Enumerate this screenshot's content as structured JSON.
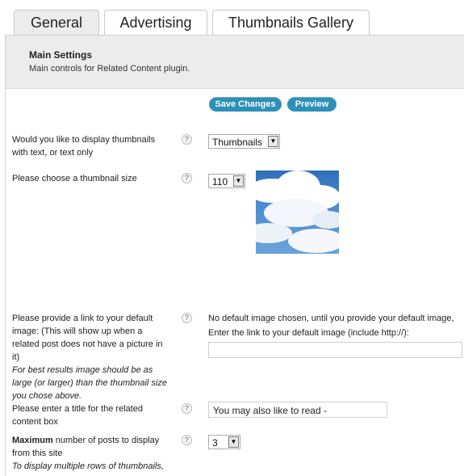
{
  "tabs": {
    "general": "General",
    "advertising": "Advertising",
    "thumbnails_gallery": "Thumbnails Gallery"
  },
  "header": {
    "title": "Main Settings",
    "description": "Main controls for Related Content plugin."
  },
  "buttons": {
    "save": "Save Changes",
    "preview": "Preview"
  },
  "settings": {
    "display_mode": {
      "label_line1": "Would you like to display thumbnails",
      "label_line2": "with text, or text only",
      "value": "Thumbnails"
    },
    "thumbnail_size": {
      "label": "Please choose a thumbnail size",
      "value": "110"
    },
    "default_image": {
      "label_lines": [
        "Please provide a link to your default",
        "image: (This will show up when a",
        "related post does not have a picture in",
        "it)"
      ],
      "hint_lines": [
        "For best results image should be as",
        "large (or larger) than the thumbnail size",
        "you chose above."
      ],
      "status": "No default image chosen, until you provide your default image,",
      "link_prompt": "Enter the link to your default image (include http://):",
      "link_value": ""
    },
    "title": {
      "label_line1": "Please enter a title for the related",
      "label_line2": "content box",
      "value": "You may also like to read -"
    },
    "max_posts": {
      "label_bold": "Maximum",
      "label_rest": " number of posts to display",
      "label_line2": "from this site",
      "hint": "To display multiple rows of thumbnails,",
      "value": "3"
    }
  },
  "icons": {
    "help": "?",
    "dropdown": "▼"
  }
}
